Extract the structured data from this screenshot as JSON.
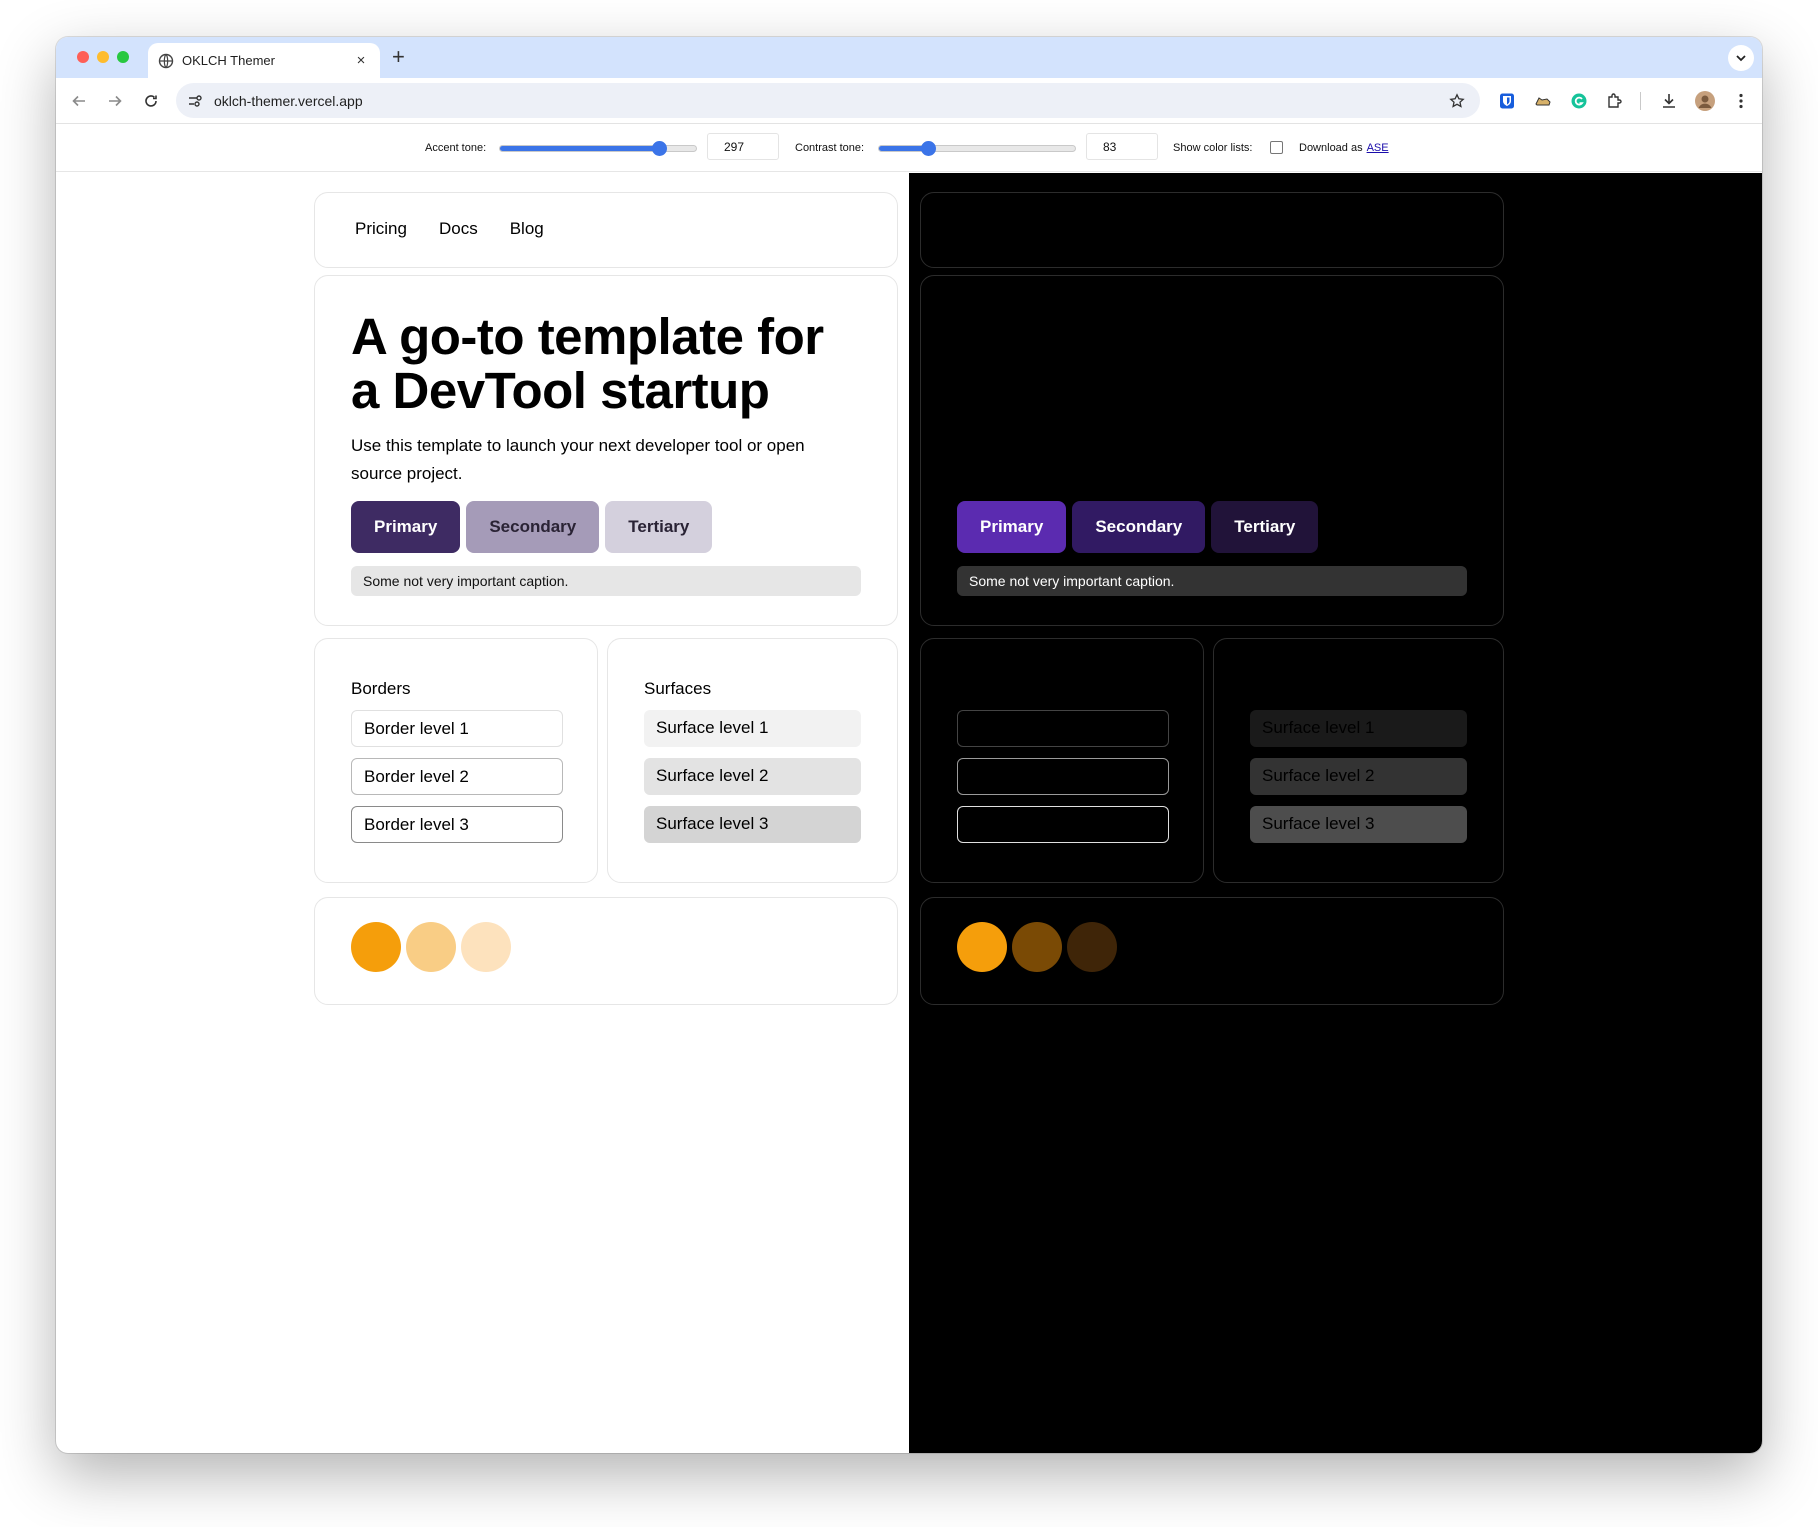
{
  "browser": {
    "tab_title": "OKLCH Themer",
    "tab_close": "×",
    "new_tab": "+",
    "url": "oklch-themer.vercel.app"
  },
  "controls": {
    "accent_label": "Accent tone:",
    "accent_value": "297",
    "accent_fraction": 0.81,
    "contrast_label": "Contrast tone:",
    "contrast_value": "83",
    "contrast_fraction": 0.25,
    "color_lists_label": "Show color lists:",
    "color_lists_checked": false,
    "download_label": "Download as",
    "download_link": "ASE"
  },
  "nav": {
    "items": [
      "Pricing",
      "Docs",
      "Blog"
    ]
  },
  "hero": {
    "title": "A go-to template for a DevTool startup",
    "subtitle": "Use this template to launch your next developer tool or open source project.",
    "primary": "Primary",
    "secondary": "Secondary",
    "tertiary": "Tertiary",
    "caption": "Some not very important caption."
  },
  "borders": {
    "title": "Borders",
    "levels": [
      "Border level 1",
      "Border level 2",
      "Border level 3"
    ]
  },
  "surfaces": {
    "title": "Surfaces",
    "levels": [
      "Surface level 1",
      "Surface level 2",
      "Surface level 3"
    ]
  },
  "theme_colors": {
    "light": {
      "primary_bg": "#3e2b63",
      "primary_fg": "#ffffff",
      "secondary_bg": "#a59bb8",
      "secondary_fg": "#2a2335",
      "tertiary_bg": "#d4d0dd",
      "tertiary_fg": "#2a2335",
      "caption_bg": "#e6e6e6",
      "caption_fg": "#111111",
      "borders": [
        "#e0e0e0",
        "#b8b8b8",
        "#8a8a8a"
      ],
      "surfaces": [
        "#f2f2f2",
        "#e3e3e3",
        "#d4d4d4"
      ],
      "swatches": [
        "#f59e0b",
        "#f9cd85",
        "#fde2bd"
      ]
    },
    "dark": {
      "primary_bg": "#5b2bb0",
      "primary_fg": "#ffffff",
      "secondary_bg": "#311a63",
      "secondary_fg": "#ffffff",
      "tertiary_bg": "#211339",
      "tertiary_fg": "#ffffff",
      "caption_bg": "#333333",
      "caption_fg": "#ffffff",
      "borders": [
        "#444444",
        "#9a9a9a",
        "#e0e0e0"
      ],
      "surfaces": [
        "#1a1a1a",
        "#333333",
        "#4d4d4d"
      ],
      "swatches": [
        "#f59e0b",
        "#7a4a05",
        "#3f2508"
      ]
    }
  }
}
